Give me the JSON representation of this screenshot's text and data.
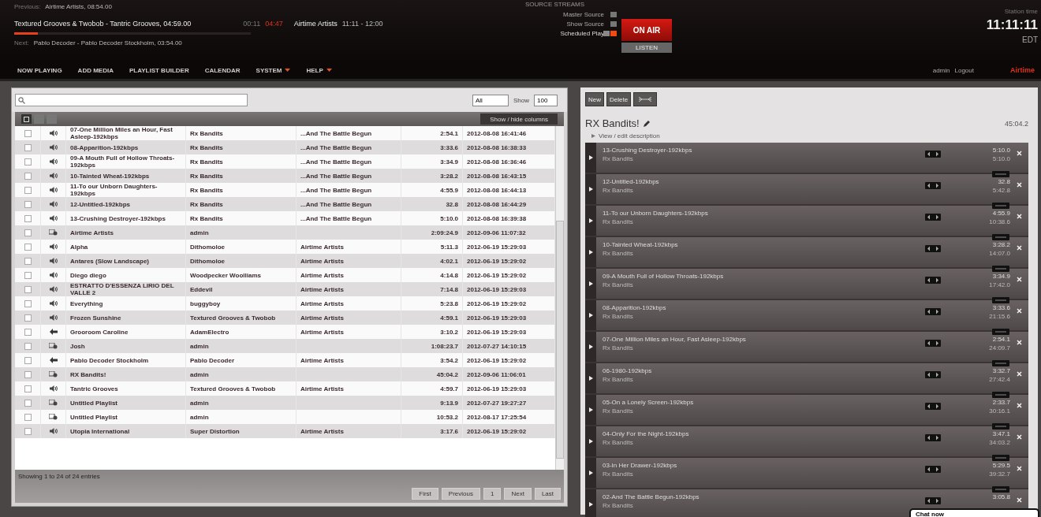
{
  "header": {
    "previous_label": "Previous:",
    "previous": "Airtime Artists, 08:54.00",
    "current": "Textured Grooves & Twobob - Tantric Grooves, 04:59.00",
    "level": 0.1,
    "next_label": "Next:",
    "next": "Pablo Decoder - Pablo Decoder Stockholm, 03:54.00",
    "elapsed": "00:11",
    "remaining": "04:47",
    "show": "Airtime Artists",
    "show_time": "11:11 - 12:00",
    "sources_title": "SOURCE STREAMS",
    "sources": [
      {
        "label": "Master Source",
        "on": false
      },
      {
        "label": "Show Source",
        "on": false
      },
      {
        "label": "Scheduled Play",
        "on": true
      }
    ],
    "on_air": "ON AIR",
    "listen": "LISTEN",
    "station_time_label": "Station time",
    "station_time": "11:11:11",
    "timezone": "EDT"
  },
  "nav": [
    {
      "label": "NOW PLAYING",
      "caret": false
    },
    {
      "label": "ADD MEDIA",
      "caret": false
    },
    {
      "label": "PLAYLIST BUILDER",
      "caret": false
    },
    {
      "label": "CALENDAR",
      "caret": false
    },
    {
      "label": "SYSTEM",
      "caret": true
    },
    {
      "label": "HELP",
      "caret": true
    }
  ],
  "user": {
    "name": "admin",
    "logout": "Logout",
    "logo": "Airtime"
  },
  "library": {
    "filter": "All",
    "show_label": "Show",
    "show_count": "100",
    "columns_button": "Show / hide columns",
    "rows": [
      {
        "kind": "audio",
        "checked": false,
        "title": "07-One Million Miles an Hour, Fast Asleep-192kbps",
        "creator": "Rx Bandits",
        "album": "...And The Battle Begun",
        "length": "2:54.1",
        "uploaded": "2012-08-08 16:41:46"
      },
      {
        "kind": "audio",
        "checked": false,
        "title": "08-Apparition-192kbps",
        "creator": "Rx Bandits",
        "album": "...And The Battle Begun",
        "length": "3:33.6",
        "uploaded": "2012-08-08 16:38:33"
      },
      {
        "kind": "audio",
        "checked": false,
        "title": "09-A Mouth Full of Hollow Throats-192kbps",
        "creator": "Rx Bandits",
        "album": "...And The Battle Begun",
        "length": "3:34.9",
        "uploaded": "2012-08-08 16:36:46"
      },
      {
        "kind": "audio",
        "checked": false,
        "title": "10-Tainted Wheat-192kbps",
        "creator": "Rx Bandits",
        "album": "...And The Battle Begun",
        "length": "3:28.2",
        "uploaded": "2012-08-08 16:43:15"
      },
      {
        "kind": "audio",
        "checked": false,
        "title": "11-To our Unborn Daughters-192kbps",
        "creator": "Rx Bandits",
        "album": "...And The Battle Begun",
        "length": "4:55.9",
        "uploaded": "2012-08-08 16:44:13"
      },
      {
        "kind": "audio",
        "checked": false,
        "title": "12-Untitled-192kbps",
        "creator": "Rx Bandits",
        "album": "...And The Battle Begun",
        "length": "32.8",
        "uploaded": "2012-08-08 16:44:29"
      },
      {
        "kind": "audio",
        "checked": false,
        "title": "13-Crushing Destroyer-192kbps",
        "creator": "Rx Bandits",
        "album": "...And The Battle Begun",
        "length": "5:10.0",
        "uploaded": "2012-08-08 16:39:38"
      },
      {
        "kind": "playlist",
        "checked": false,
        "title": "Airtime Artists",
        "creator": "admin",
        "album": "",
        "length": "2:09:24.9",
        "uploaded": "2012-09-06 11:07:32"
      },
      {
        "kind": "audio",
        "checked": false,
        "title": "Alpha",
        "creator": "Dithomoloe",
        "album": "Airtime Artists",
        "length": "5:11.3",
        "uploaded": "2012-06-19 15:29:03"
      },
      {
        "kind": "audio",
        "checked": false,
        "title": "Antares (Slow Landscape)",
        "creator": "Dithomoloe",
        "album": "Airtime Artists",
        "length": "4:02.1",
        "uploaded": "2012-06-19 15:29:02"
      },
      {
        "kind": "audio",
        "checked": false,
        "title": "Diego diego",
        "creator": "Woodpecker Woolliams",
        "album": "Airtime Artists",
        "length": "4:14.8",
        "uploaded": "2012-06-19 15:29:02"
      },
      {
        "kind": "audio",
        "checked": false,
        "title": "ESTRATTO D'ESSENZA LIRIO DEL VALLE 2",
        "creator": "Eddevil",
        "album": "Airtime Artists",
        "length": "7:14.8",
        "uploaded": "2012-06-19 15:29:03"
      },
      {
        "kind": "audio",
        "checked": false,
        "title": "Everything",
        "creator": "buggyboy",
        "album": "Airtime Artists",
        "length": "5:23.8",
        "uploaded": "2012-06-19 15:29:02"
      },
      {
        "kind": "audio",
        "checked": false,
        "title": "Frozen Sunshine",
        "creator": "Textured Grooves & Twobob",
        "album": "Airtime Artists",
        "length": "4:59.1",
        "uploaded": "2012-06-19 15:29:03"
      },
      {
        "kind": "stream",
        "checked": false,
        "title": "Grooroom Caroline",
        "creator": "AdamElectro",
        "album": "Airtime Artists",
        "length": "3:10.2",
        "uploaded": "2012-06-19 15:29:03"
      },
      {
        "kind": "playlist",
        "checked": false,
        "title": "Josh",
        "creator": "admin",
        "album": "",
        "length": "1:08:23.7",
        "uploaded": "2012-07-27 14:10:15"
      },
      {
        "kind": "stream",
        "checked": false,
        "title": "Pablo Decoder Stockholm",
        "creator": "Pablo Decoder",
        "album": "Airtime Artists",
        "length": "3:54.2",
        "uploaded": "2012-06-19 15:29:02"
      },
      {
        "kind": "playlist",
        "checked": false,
        "title": "RX Bandits!",
        "creator": "admin",
        "album": "",
        "length": "45:04.2",
        "uploaded": "2012-09-06 11:06:01"
      },
      {
        "kind": "audio",
        "checked": false,
        "title": "Tantric Grooves",
        "creator": "Textured Grooves & Twobob",
        "album": "Airtime Artists",
        "length": "4:59.7",
        "uploaded": "2012-06-19 15:29:03"
      },
      {
        "kind": "playlist",
        "checked": false,
        "title": "Untitled Playlist",
        "creator": "admin",
        "album": "",
        "length": "9:13.9",
        "uploaded": "2012-07-27 19:27:27"
      },
      {
        "kind": "playlist",
        "checked": false,
        "title": "Untitled Playlist",
        "creator": "admin",
        "album": "",
        "length": "10:53.2",
        "uploaded": "2012-08-17 17:25:54"
      },
      {
        "kind": "audio",
        "checked": false,
        "title": "Utopia International",
        "creator": "Super Distortion",
        "album": "Airtime Artists",
        "length": "3:17.6",
        "uploaded": "2012-06-19 15:29:02"
      }
    ],
    "info": "Showing 1 to 24 of 24 entries",
    "pager": [
      "First",
      "Previous",
      "1",
      "Next",
      "Last"
    ]
  },
  "playlist": {
    "buttons": [
      "New",
      "Delete"
    ],
    "title": "RX Bandits!",
    "length": "45:04.2",
    "description_link": "View / edit description",
    "items": [
      {
        "title": "13-Crushing Destroyer-192kbps",
        "artist": "Rx Bandits",
        "length": "5:10.0",
        "total": "5:10.0"
      },
      {
        "title": "12-Untitled-192kbps",
        "artist": "Rx Bandits",
        "length": "32.8",
        "total": "5:42.8"
      },
      {
        "title": "11-To our Unborn Daughters-192kbps",
        "artist": "Rx Bandits",
        "length": "4:55.9",
        "total": "10:38.6"
      },
      {
        "title": "10-Tainted Wheat-192kbps",
        "artist": "Rx Bandits",
        "length": "3:28.2",
        "total": "14:07.0"
      },
      {
        "title": "09-A Mouth Full of Hollow Throats-192kbps",
        "artist": "Rx Bandits",
        "length": "3:34.9",
        "total": "17:42.0"
      },
      {
        "title": "08-Apparition-192kbps",
        "artist": "Rx Bandits",
        "length": "3:33.6",
        "total": "21:15.6"
      },
      {
        "title": "07-One Million Miles an Hour, Fast Asleep-192kbps",
        "artist": "Rx Bandits",
        "length": "2:54.1",
        "total": "24:09.7"
      },
      {
        "title": "06-1980-192kbps",
        "artist": "Rx Bandits",
        "length": "3:32.7",
        "total": "27:42.4"
      },
      {
        "title": "05-On a Lonely Screen-192kbps",
        "artist": "Rx Bandits",
        "length": "2:33.7",
        "total": "30:16.1"
      },
      {
        "title": "04-Only For the Night-192kbps",
        "artist": "Rx Bandits",
        "length": "3:47.1",
        "total": "34:03.2"
      },
      {
        "title": "03-In Her Drawer-192kbps",
        "artist": "Rx Bandits",
        "length": "5:29.5",
        "total": "39:32.7"
      },
      {
        "title": "02-And The Battle Begun-192kbps",
        "artist": "Rx Bandits",
        "length": "3:05.8"
      }
    ]
  },
  "chat": {
    "label": "Chat now"
  }
}
